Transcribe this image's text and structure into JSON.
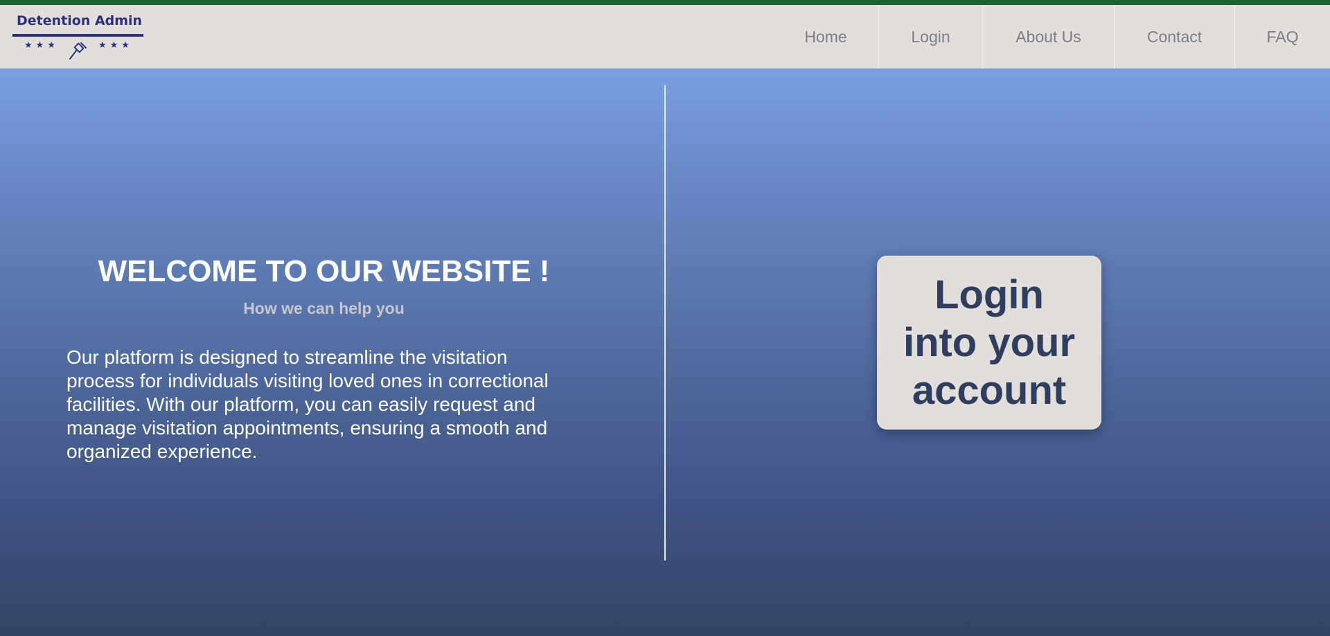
{
  "brand": {
    "name": "Detention Admin",
    "stars": "★★★",
    "logo_color": "#2c2f7e"
  },
  "nav": {
    "items": [
      {
        "label": "Home"
      },
      {
        "label": "Login"
      },
      {
        "label": "About Us"
      },
      {
        "label": "Contact"
      },
      {
        "label": "FAQ"
      }
    ]
  },
  "hero": {
    "title": "WELCOME TO OUR WEBSITE !",
    "subtitle": "How we can help you",
    "body": "Our platform is designed to streamline the visitation process for individuals visiting loved ones in correctional facilities. With our platform, you can easily request and manage visitation appointments, ensuring a smooth and organized experience.",
    "login_card_label": "Login into your account"
  },
  "colors": {
    "top_strip": "#1d6133",
    "navbar_bg": "#e2dedb",
    "nav_text": "#7d7e84",
    "hero_gradient_top": "#7a9fe0",
    "hero_gradient_bottom": "#344464",
    "card_text": "#2f3e5e"
  },
  "icons": {
    "logo_emblem": "gavel-icon"
  }
}
